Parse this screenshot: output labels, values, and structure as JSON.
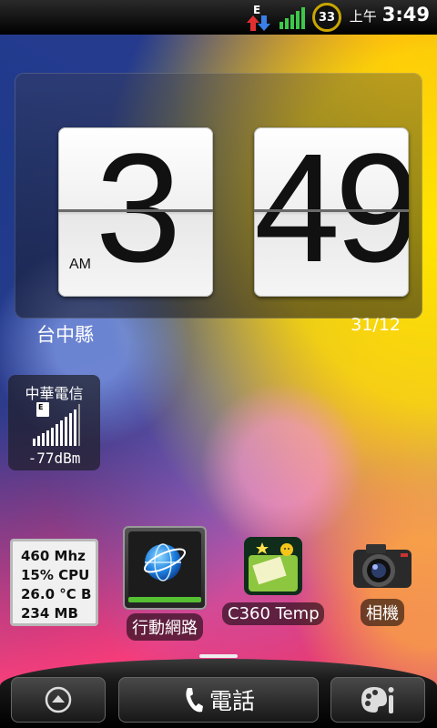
{
  "status_bar": {
    "network_type": "E",
    "battery_level": "33",
    "time_period": "上午",
    "time": "3:49"
  },
  "clock_widget": {
    "hours": "3",
    "minutes": "49",
    "am_pm": "AM",
    "location": "台中縣",
    "date": "31/12"
  },
  "signal_widget": {
    "carrier": "中華電信",
    "network_type": "E",
    "signal_strength": "-77dBm"
  },
  "system_widget": {
    "lines": [
      "460 Mhz",
      "15% CPU",
      "26.0 °C B",
      "234 MB"
    ]
  },
  "apps": [
    {
      "label": "行動網路",
      "icon": "mobile-network-globe-icon"
    },
    {
      "label": "C360 Temp",
      "icon": "c360-icon"
    },
    {
      "label": "相機",
      "icon": "camera-icon"
    }
  ],
  "dock": {
    "phone_label": "電話",
    "home_icon": "up-arrow-icon",
    "personalize_icon": "personalize-icon"
  },
  "colors": {
    "status_bar": "#000000",
    "battery_ring": "#c9a600",
    "mobile_data_on": "#55c032"
  }
}
